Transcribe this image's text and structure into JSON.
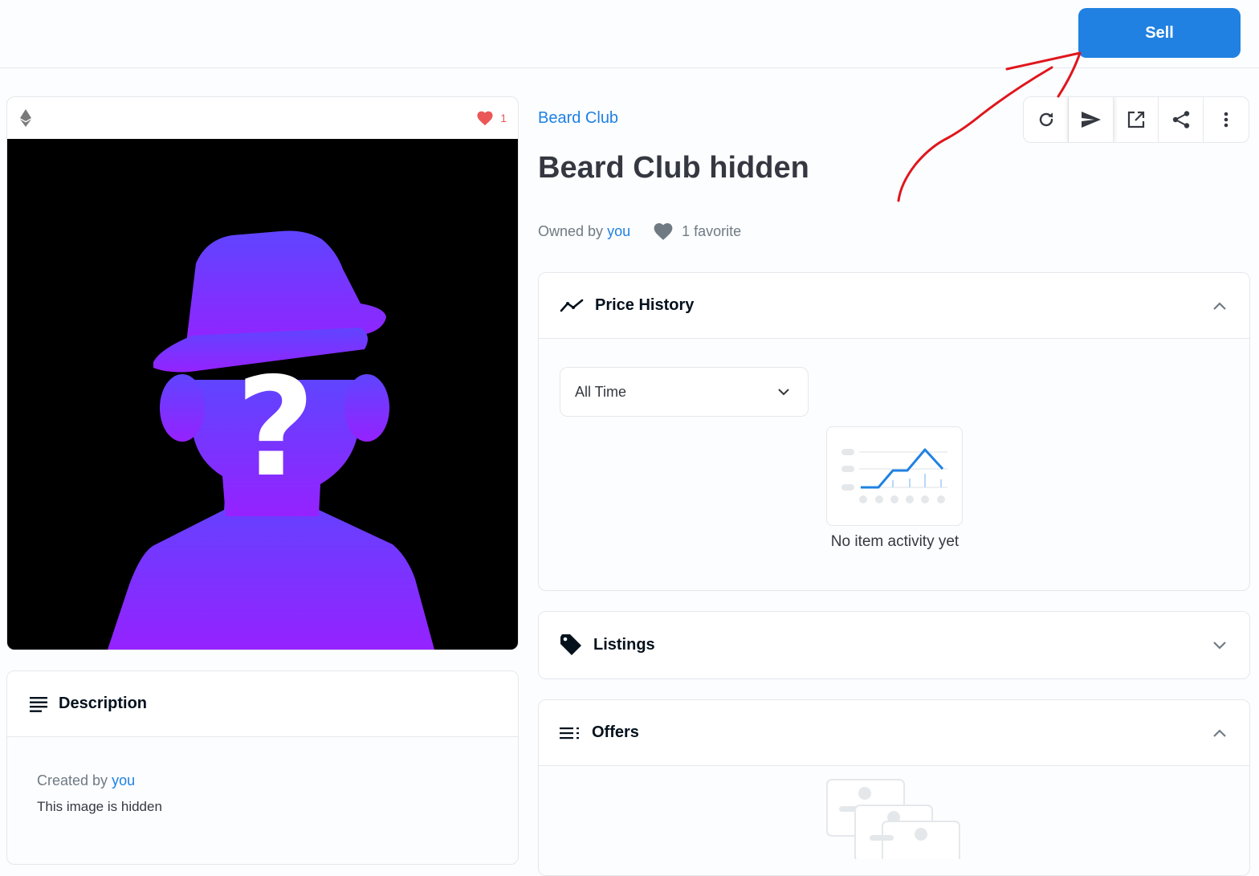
{
  "header": {
    "sell_label": "Sell"
  },
  "media": {
    "favorite_count": "1"
  },
  "item": {
    "collection": "Beard Club",
    "title": "Beard Club hidden",
    "owned_by_prefix": "Owned by",
    "owner": "you",
    "favorites_text": "1 favorite"
  },
  "actions": [
    {
      "icon": "refresh-icon"
    },
    {
      "icon": "send-icon"
    },
    {
      "icon": "external-link-icon"
    },
    {
      "icon": "share-icon"
    },
    {
      "icon": "more-icon"
    }
  ],
  "price_history": {
    "title": "Price History",
    "time_filter": "All Time",
    "empty_text": "No item activity yet"
  },
  "listings": {
    "title": "Listings"
  },
  "offers": {
    "title": "Offers"
  },
  "description": {
    "title": "Description",
    "created_by_prefix": "Created by",
    "creator": "you",
    "text": "This image is hidden"
  },
  "colors": {
    "accent": "#2081e2",
    "heart": "#eb5757",
    "annotation": "#e0161c",
    "silhouette_top": "#5f45ff",
    "silhouette_bottom": "#9522ff"
  }
}
